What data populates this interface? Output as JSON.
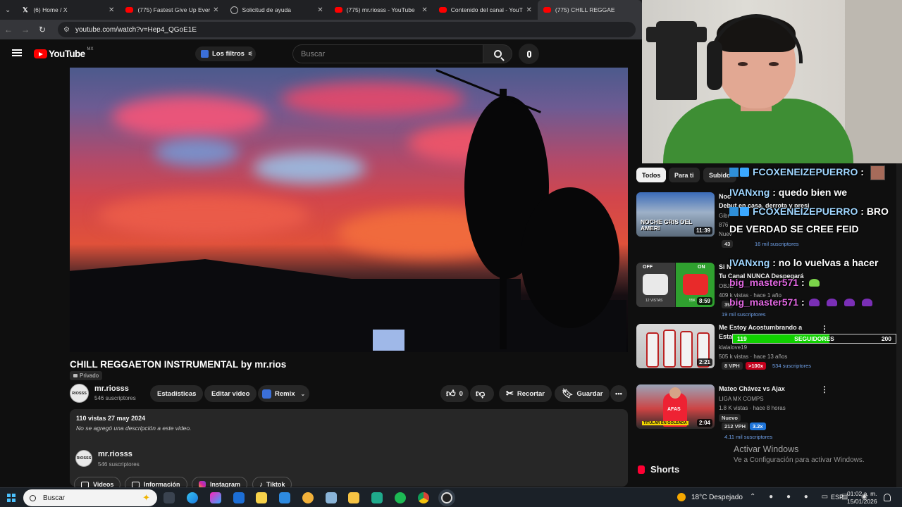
{
  "browser": {
    "tabs": [
      {
        "title": "(6) Home / X",
        "icon": "x-icon"
      },
      {
        "title": "(775) Fastest Give Up Ever 😭😭",
        "icon": "youtube-icon"
      },
      {
        "title": "Solicitud de ayuda",
        "icon": "help-icon"
      },
      {
        "title": "(775) mr.riosss - YouTube",
        "icon": "youtube-icon"
      },
      {
        "title": "Contenido del canal - YouTube",
        "icon": "youtube-icon"
      },
      {
        "title": "(775) CHILL REGGAE",
        "icon": "youtube-icon"
      }
    ],
    "url": "youtube.com/watch?v=Hep4_QGoE1E"
  },
  "header": {
    "logo_text": "YouTube",
    "country": "MX",
    "filters_label": "Los filtros",
    "search_placeholder": "Buscar"
  },
  "video": {
    "title": "CHILL REGGAETON INSTRUMENTAL by mr.rios",
    "privacy": "Privado",
    "channel": "mr.riosss",
    "subscribers": "546 suscriptores",
    "avatar_text": "RIOSSS",
    "buttons": {
      "stats": "Estadísticas",
      "edit": "Editar video",
      "remix": "Remix",
      "likes": "0",
      "clip": "Recortar",
      "save": "Guardar",
      "more": "•••"
    },
    "description": {
      "meta": "110 vistas  27 may 2024",
      "text": "No se agregó una descripción a este video.",
      "channel": "mr.riosss",
      "subscribers": "546 suscriptores",
      "links": [
        "Videos",
        "Información",
        "Instagram",
        "Tiktok"
      ]
    }
  },
  "sidebar": {
    "chips": [
      "Todos",
      "Para ti",
      "Subido"
    ],
    "items": [
      {
        "title_l1": "Noc",
        "title_l2": "Debut en casa, derrota y presi",
        "channel": "Gibr",
        "views": "876",
        "badge1": "Nuev",
        "vph": "43",
        "subs": "16 mil suscriptores",
        "duration": "11:39",
        "thumb_text": "NOCHE GRIS DEL AMERI"
      },
      {
        "title_l1": "Si N",
        "title_l2": "Tu Canal NUNCA Despegará",
        "channel": "OBJE",
        "views": "409 k vistas · hace 1 año",
        "vph": "39",
        "subs": "19 mil suscriptores",
        "duration": "8:59",
        "thumb_off": "OFF",
        "thumb_on": "ON",
        "thumb_left": "12 VISTAS",
        "thumb_right": "55K"
      },
      {
        "title_l1": "Me Estoy Acostumbrando a",
        "title_l2": "Estar",
        "channel": "klalalove19",
        "views": "505 k vistas · hace 13 años",
        "vph": "8 VPH",
        "ratio": ">100x",
        "subs": "534 suscriptores",
        "duration": "2:21"
      },
      {
        "title_l1": "Mateo Chávez vs Ajax",
        "channel": "LIGA MX COMPS",
        "views": "1.8 K vistas · hace 8 horas",
        "badge1": "Nuevo",
        "vph": "212 VPH",
        "ratio": "3.2x",
        "subs": "4.11 mil suscriptores",
        "duration": "2:04",
        "thumb_text": "TITULAR EN GOLEADA",
        "thumb_sponsor": "AFAS"
      }
    ],
    "shorts_label": "Shorts"
  },
  "chat": {
    "lines": [
      {
        "user": "FCOXENEIZEPUERRO",
        "sep": " :",
        "msg": ""
      },
      {
        "user": "IVANxng",
        "sep": " : ",
        "msg": "quedo bien we"
      },
      {
        "user": "FCOXENEIZEPUERRO",
        "sep": " : ",
        "msg": "BRO"
      },
      {
        "user": "",
        "sep": "",
        "msg": "DE VERDAD SE CREE FEID"
      },
      {
        "user": "IVANxng",
        "sep": " : ",
        "msg": "no lo vuelvas a hacer"
      },
      {
        "user": "big_master571",
        "sep": " :",
        "msg": ""
      },
      {
        "user": "big_master571",
        "sep": " :",
        "msg": ""
      }
    ]
  },
  "follow_goal": {
    "current": "119",
    "label": "SEGUIDORES",
    "goal": "200",
    "progress": 0.595
  },
  "windows_activation": {
    "title": "Activar Windows",
    "subtitle": "Ve a Configuración para activar Windows."
  },
  "taskbar": {
    "search_label": "Buscar",
    "weather": "18°C  Despejado",
    "language": "ESP",
    "time": "01:02 a. m.",
    "date": "15/01/2026"
  },
  "colors": {
    "youtube_red": "#ff0000",
    "follow_bar": "#10d000",
    "chat_user": "#9fd6ff",
    "chat_user_alt": "#e268e2"
  }
}
